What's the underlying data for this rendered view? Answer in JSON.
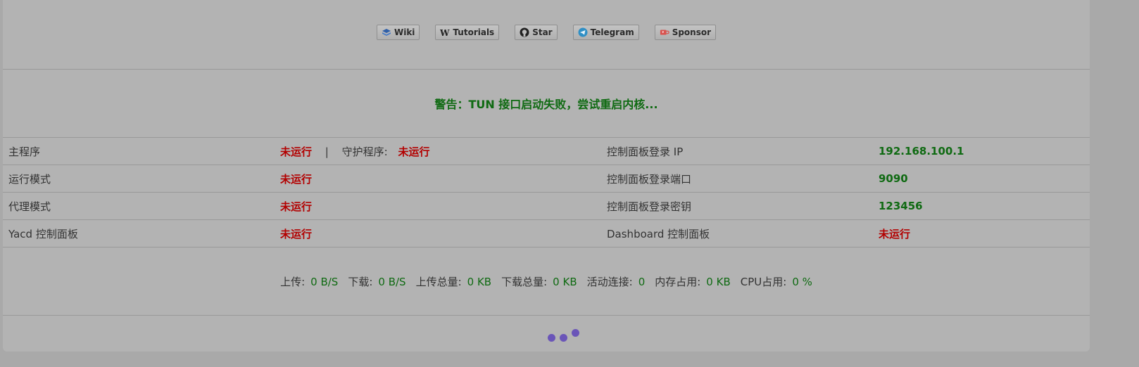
{
  "toolbar": {
    "buttons": [
      {
        "label": "Wiki",
        "icon": "book-icon"
      },
      {
        "label": "Tutorials",
        "icon": "wikipedia-w-icon"
      },
      {
        "label": "Star",
        "icon": "github-icon"
      },
      {
        "label": "Telegram",
        "icon": "telegram-icon"
      },
      {
        "label": "Sponsor",
        "icon": "coffee-cup-icon"
      }
    ]
  },
  "warning": "警告：TUN 接口启动失败，尝试重启内核...",
  "status": {
    "rows": [
      {
        "label": "主程序",
        "value": "未运行",
        "guard_label": "守护程序:",
        "guard_value": "未运行",
        "right_label": "控制面板登录 IP",
        "right_value": "192.168.100.1"
      },
      {
        "label": "运行模式",
        "value": "未运行",
        "right_label": "控制面板登录端口",
        "right_value": "9090"
      },
      {
        "label": "代理模式",
        "value": "未运行",
        "right_label": "控制面板登录密钥",
        "right_value": "123456"
      },
      {
        "label": "Yacd 控制面板",
        "value": "未运行",
        "right_label": "Dashboard 控制面板",
        "right_value": "未运行"
      }
    ],
    "separator": "|"
  },
  "traffic": {
    "upload_label": "上传:",
    "upload_value": "0 B/S",
    "download_label": "下载:",
    "download_value": "0 B/S",
    "upload_total_label": "上传总量:",
    "upload_total_value": "0 KB",
    "download_total_label": "下载总量:",
    "download_total_value": "0 KB",
    "connections_label": "活动连接:",
    "connections_value": "0",
    "memory_label": "内存占用:",
    "memory_value": "0 KB",
    "cpu_label": "CPU占用:",
    "cpu_value": "0 %"
  },
  "colors": {
    "running_false": "#b30000",
    "value_green": "#0f6a12",
    "loader": "#6a55b8"
  }
}
